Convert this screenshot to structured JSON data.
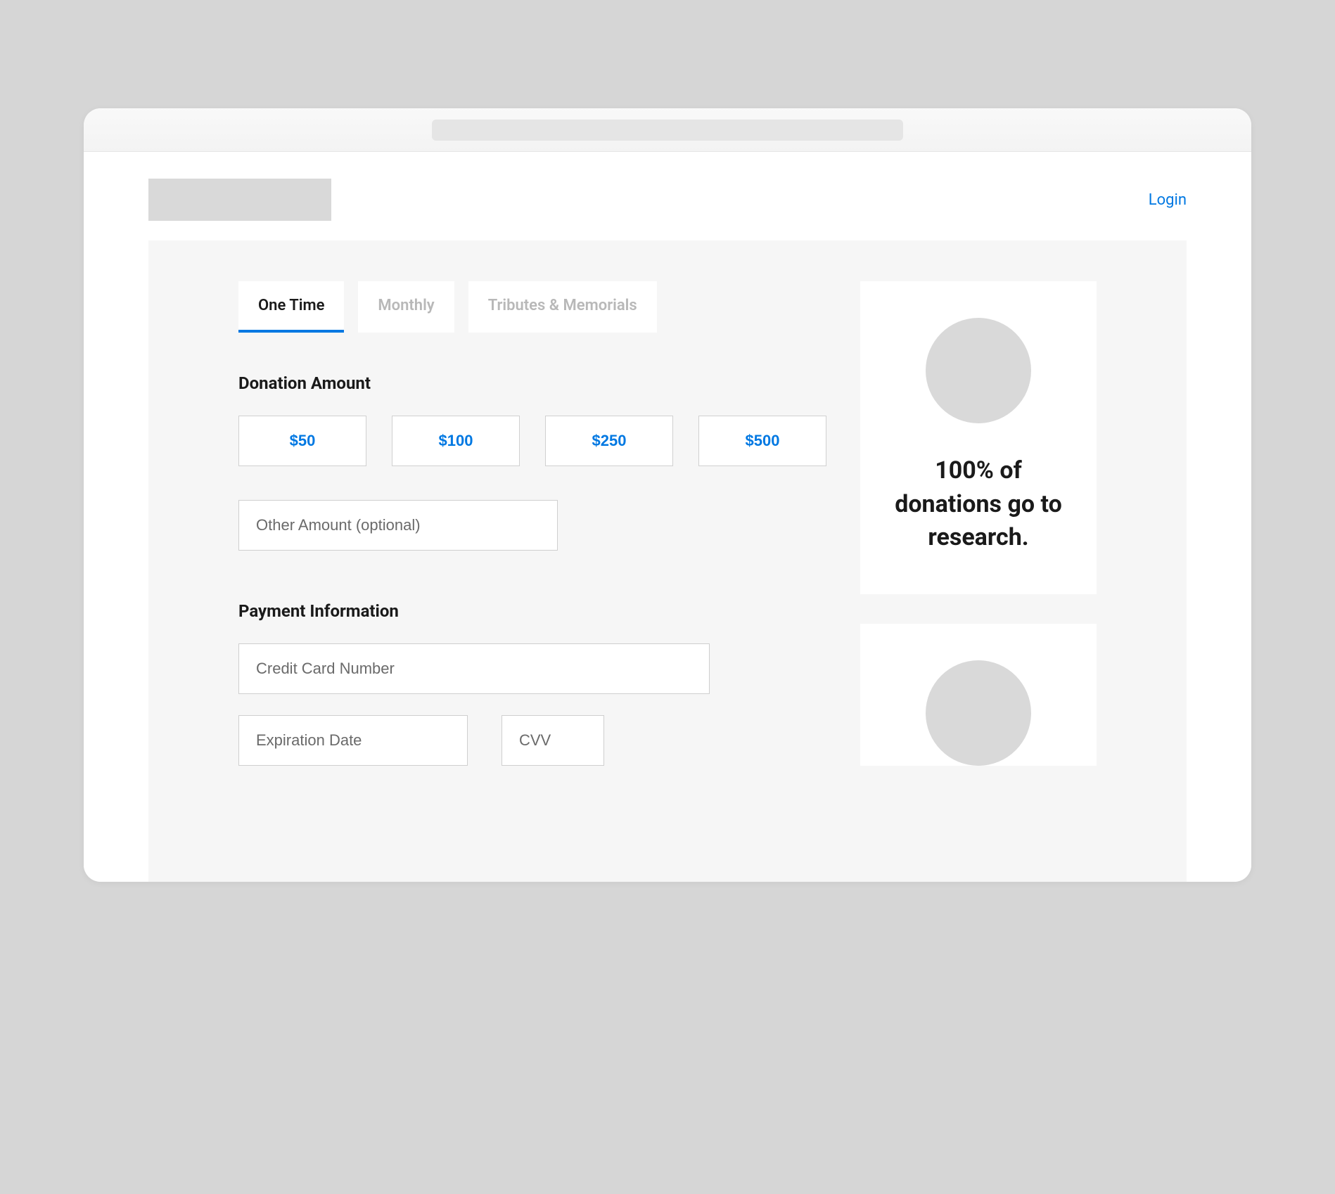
{
  "header": {
    "login_label": "Login"
  },
  "tabs": [
    {
      "id": "one-time",
      "label": "One Time",
      "active": true
    },
    {
      "id": "monthly",
      "label": "Monthly",
      "active": false
    },
    {
      "id": "tributes",
      "label": "Tributes & Memorials",
      "active": false
    }
  ],
  "donation": {
    "section_title": "Donation Amount",
    "amounts": [
      "$50",
      "$100",
      "$250",
      "$500"
    ],
    "other_placeholder": "Other Amount (optional)"
  },
  "payment": {
    "section_title": "Payment Information",
    "card_placeholder": "Credit Card Number",
    "expiration_placeholder": "Expiration Date",
    "cvv_placeholder": "CVV"
  },
  "sidebar": {
    "cards": [
      {
        "headline": "100% of donations go to research."
      }
    ]
  }
}
